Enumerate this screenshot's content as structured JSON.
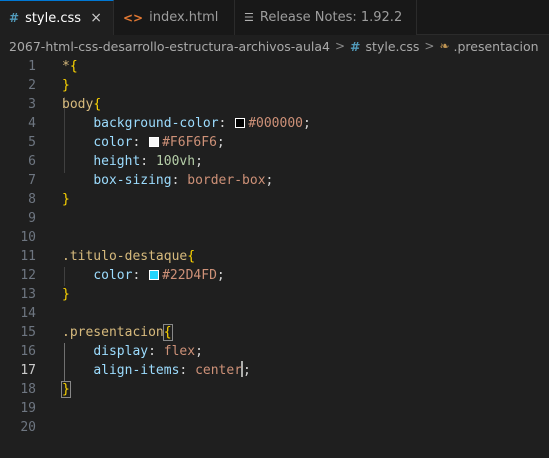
{
  "tabs": [
    {
      "label": "style.css",
      "icon": "css-hash-icon",
      "active": true,
      "close": "×"
    },
    {
      "label": "index.html",
      "icon": "html-brackets-icon",
      "active": false
    },
    {
      "label": "Release Notes: 1.92.2",
      "icon": "release-notes-icon",
      "active": false
    }
  ],
  "breadcrumb": {
    "folder": "2067-html-css-desarrollo-estructura-archivos-aula4",
    "file": "style.css",
    "symbol": ".presentacion",
    "separator": ">"
  },
  "editor": {
    "line_numbers": [
      "1",
      "2",
      "3",
      "4",
      "5",
      "6",
      "7",
      "8",
      "9",
      "10",
      "11",
      "12",
      "13",
      "14",
      "15",
      "16",
      "17",
      "18",
      "19",
      "20"
    ],
    "current_line": "19",
    "code": {
      "l1_selector": "*",
      "l1_brace": "{",
      "l2_brace": "}",
      "l3_selector": "body",
      "l3_brace": "{",
      "l4_prop": "background-color",
      "l4_value": "#000000",
      "l5_prop": "color",
      "l5_value": "#F6F6F6",
      "l6_prop": "height",
      "l6_value": "100vh",
      "l7_prop": "box-sizing",
      "l7_value": "border-box",
      "l8_brace": "}",
      "l9_selector": ".titulo-destaque",
      "l9_brace": "{",
      "l10_prop": "color",
      "l10_value": "#22D4FD",
      "l11_brace": "}",
      "l12_selector": ".presentacion",
      "l12_brace": "{",
      "l13_prop": "display",
      "l13_value": "flex",
      "l14_prop": "align-items",
      "l14_value": "center",
      "l15_brace": "}"
    },
    "swatch_colors": {
      "background": "#000000",
      "color": "#F6F6F6",
      "titulo": "#22D4FD"
    }
  }
}
